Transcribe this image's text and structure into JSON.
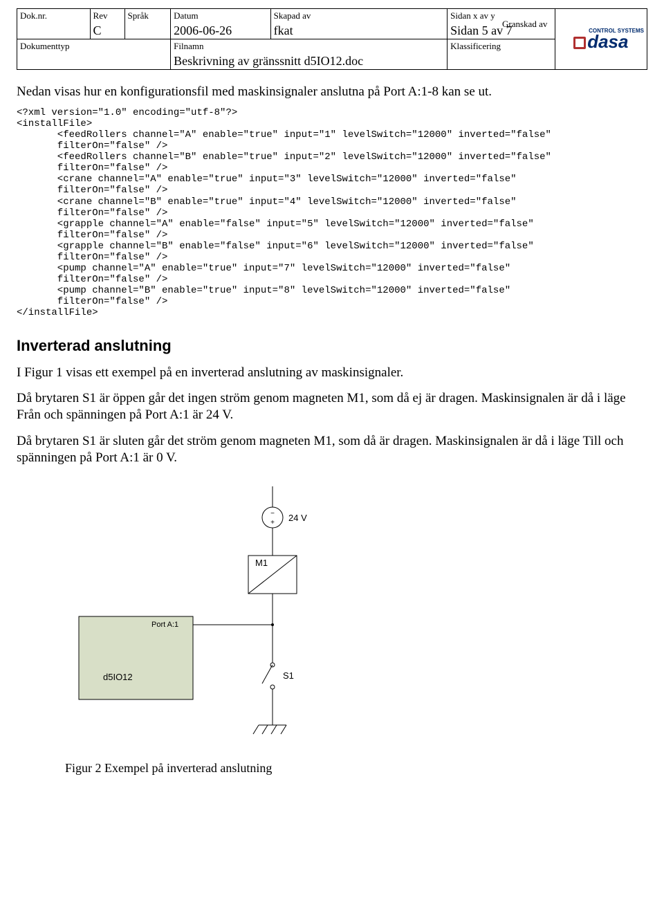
{
  "header": {
    "labels": {
      "doknr": "Dok.nr.",
      "rev": "Rev",
      "sprak": "Språk",
      "datum": "Datum",
      "skapad": "Skapad av",
      "sidan": "Sidan x av y",
      "doktyp": "Dokumenttyp",
      "filnamn": "Filnamn",
      "klass": "Klassificering",
      "granskad": "Granskad av"
    },
    "values": {
      "rev": "C",
      "datum": "2006-06-26",
      "skapad": "fkat",
      "sidan": "Sidan 5 av 7",
      "filnamn": "Beskrivning av gränssnitt d5IO12.doc"
    },
    "logo": {
      "sub": "CONTROL SYSTEMS",
      "name": "dasa"
    }
  },
  "intro": "Nedan visas hur en konfigurationsfil med maskinsignaler anslutna på Port A:1-8 kan se ut.",
  "xml_lines": [
    "<?xml version=\"1.0\" encoding=\"utf-8\"?>",
    "<installFile>",
    "       <feedRollers channel=\"A\" enable=\"true\" input=\"1\" levelSwitch=\"12000\" inverted=\"false\"",
    "       filterOn=\"false\" />",
    "       <feedRollers channel=\"B\" enable=\"true\" input=\"2\" levelSwitch=\"12000\" inverted=\"false\"",
    "       filterOn=\"false\" />",
    "       <crane channel=\"A\" enable=\"true\" input=\"3\" levelSwitch=\"12000\" inverted=\"false\"",
    "       filterOn=\"false\" />",
    "       <crane channel=\"B\" enable=\"true\" input=\"4\" levelSwitch=\"12000\" inverted=\"false\"",
    "       filterOn=\"false\" />",
    "       <grapple channel=\"A\" enable=\"false\" input=\"5\" levelSwitch=\"12000\" inverted=\"false\"",
    "       filterOn=\"false\" />",
    "       <grapple channel=\"B\" enable=\"false\" input=\"6\" levelSwitch=\"12000\" inverted=\"false\"",
    "       filterOn=\"false\" />",
    "       <pump channel=\"A\" enable=\"true\" input=\"7\" levelSwitch=\"12000\" inverted=\"false\"",
    "       filterOn=\"false\" />",
    "       <pump channel=\"B\" enable=\"true\" input=\"8\" levelSwitch=\"12000\" inverted=\"false\"",
    "       filterOn=\"false\" />",
    "</installFile>"
  ],
  "section_title": "Inverterad anslutning",
  "para1": "I Figur 1 visas ett exempel på en inverterad anslutning av maskinsignaler.",
  "para2": "Då brytaren S1 är öppen går det ingen ström genom magneten M1, som då ej är dragen. Maskinsignalen är då i läge Från och spänningen på Port A:1 är 24 V.",
  "para3": "Då brytaren S1 är sluten går det ström genom magneten M1, som då är dragen. Maskinsignalen är då i läge Till och spänningen på Port A:1 är 0 V.",
  "diagram": {
    "voltage": "24 V",
    "magnet": "M1",
    "port": "Port A:1",
    "device": "d5IO12",
    "switch": "S1"
  },
  "figure_caption": "Figur 2 Exempel på inverterad anslutning"
}
